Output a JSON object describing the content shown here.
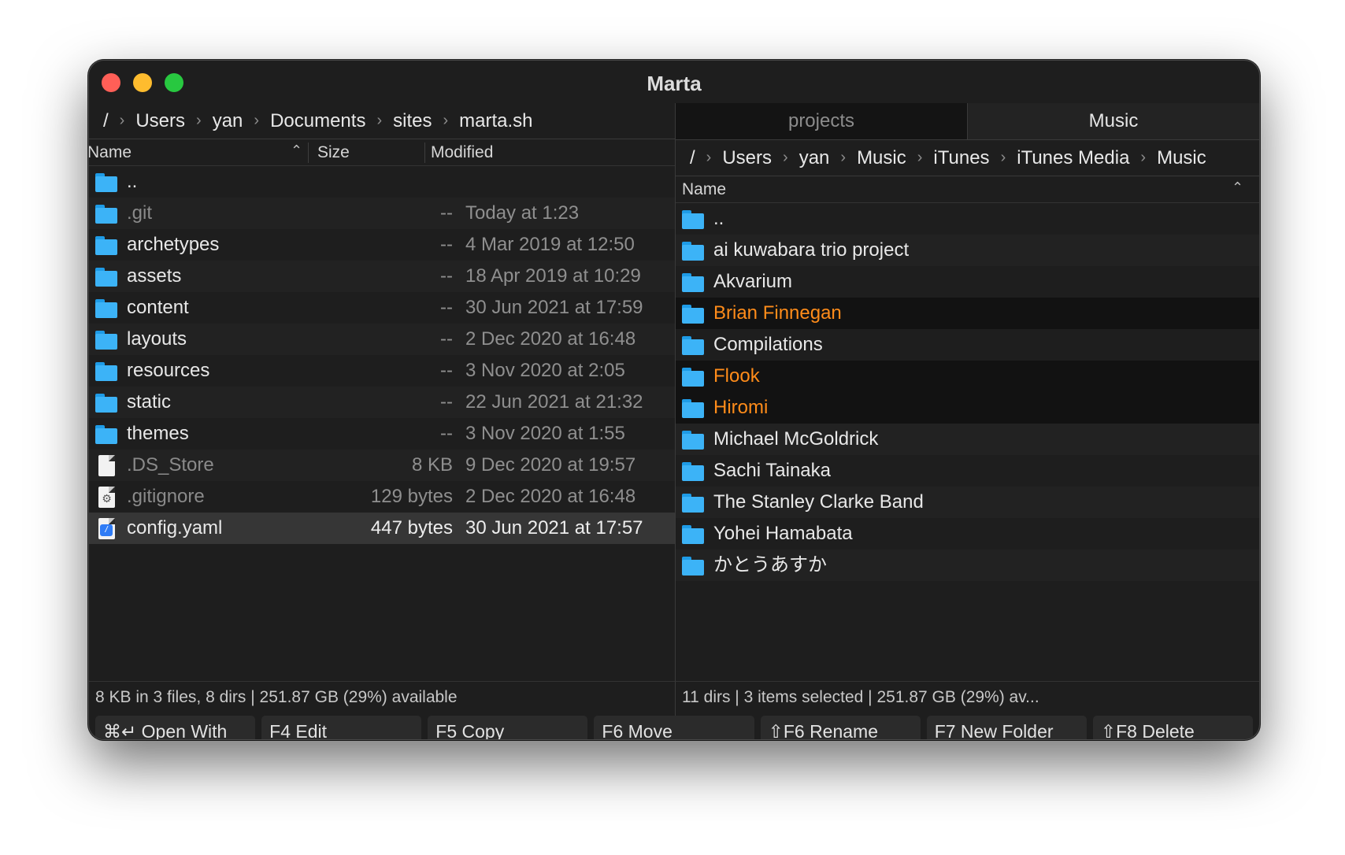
{
  "window": {
    "title": "Marta"
  },
  "left_pane": {
    "breadcrumbs": [
      "/",
      "Users",
      "yan",
      "Documents",
      "sites",
      "marta.sh"
    ],
    "columns": {
      "name": "Name",
      "size": "Size",
      "modified": "Modified"
    },
    "rows": [
      {
        "name": "..",
        "size": "",
        "modified": "",
        "type": "folder",
        "state": "normal"
      },
      {
        "name": ".git",
        "size": "--",
        "modified": "Today at 1:23",
        "type": "folder",
        "state": "dim"
      },
      {
        "name": "archetypes",
        "size": "--",
        "modified": "4 Mar 2019 at 12:50",
        "type": "folder",
        "state": "normal"
      },
      {
        "name": "assets",
        "size": "--",
        "modified": "18 Apr 2019 at 10:29",
        "type": "folder",
        "state": "normal"
      },
      {
        "name": "content",
        "size": "--",
        "modified": "30 Jun 2021 at 17:59",
        "type": "folder",
        "state": "normal"
      },
      {
        "name": "layouts",
        "size": "--",
        "modified": "2 Dec 2020 at 16:48",
        "type": "folder",
        "state": "normal"
      },
      {
        "name": "resources",
        "size": "--",
        "modified": "3 Nov 2020 at 2:05",
        "type": "folder",
        "state": "normal"
      },
      {
        "name": "static",
        "size": "--",
        "modified": "22 Jun 2021 at 21:32",
        "type": "folder",
        "state": "normal"
      },
      {
        "name": "themes",
        "size": "--",
        "modified": "3 Nov 2020 at 1:55",
        "type": "folder",
        "state": "normal"
      },
      {
        "name": ".DS_Store",
        "size": "8 KB",
        "modified": "9 Dec 2020 at 19:57",
        "type": "file",
        "state": "dim"
      },
      {
        "name": ".gitignore",
        "size": "129 bytes",
        "modified": "2 Dec 2020 at 16:48",
        "type": "gear-file",
        "state": "dim"
      },
      {
        "name": "config.yaml",
        "size": "447 bytes",
        "modified": "30 Jun 2021 at 17:57",
        "type": "yaml-file",
        "state": "selected"
      }
    ],
    "status": "8 KB in 3 files, 8 dirs  |  251.87 GB (29%) available"
  },
  "right_pane": {
    "tabs": [
      {
        "label": "projects",
        "active": false
      },
      {
        "label": "Music",
        "active": true
      }
    ],
    "breadcrumbs": [
      "/",
      "Users",
      "yan",
      "Music",
      "iTunes",
      "iTunes Media",
      "Music"
    ],
    "columns": {
      "name": "Name"
    },
    "rows": [
      {
        "name": "..",
        "state": "normal"
      },
      {
        "name": "ai kuwabara trio project",
        "state": "normal"
      },
      {
        "name": "Akvarium",
        "state": "normal"
      },
      {
        "name": "Brian Finnegan",
        "state": "marked"
      },
      {
        "name": "Compilations",
        "state": "normal"
      },
      {
        "name": "Flook",
        "state": "marked"
      },
      {
        "name": "Hiromi",
        "state": "marked"
      },
      {
        "name": "Michael McGoldrick",
        "state": "normal"
      },
      {
        "name": "Sachi Tainaka",
        "state": "normal"
      },
      {
        "name": "The Stanley Clarke Band",
        "state": "normal"
      },
      {
        "name": "Yohei Hamabata",
        "state": "normal"
      },
      {
        "name": "かとうあすか",
        "state": "normal"
      }
    ],
    "status": "11 dirs  |  3 items selected  |  251.87 GB (29%) av..."
  },
  "function_keys": [
    {
      "id": "open-with",
      "label": "⌘↵ Open With"
    },
    {
      "id": "f4-edit",
      "label": "F4 Edit"
    },
    {
      "id": "f5-copy",
      "label": "F5 Copy"
    },
    {
      "id": "f6-move",
      "label": "F6 Move"
    },
    {
      "id": "shift-f6-rename",
      "label": "⇧F6 Rename"
    },
    {
      "id": "f7-new-folder",
      "label": "F7 New Folder"
    },
    {
      "id": "shift-f8-delete",
      "label": "⇧F8 Delete"
    }
  ],
  "colors": {
    "window_bg": "#1e1e1e",
    "marked_text": "#ff8c1a",
    "folder_icon": "#3cb3f7",
    "selection_bg": "#363636"
  },
  "icons": {
    "folder": "folder-icon",
    "file": "document-icon",
    "gear-file": "gear-document-icon",
    "yaml-file": "yaml-document-icon",
    "sort": "chevron-up-icon"
  }
}
